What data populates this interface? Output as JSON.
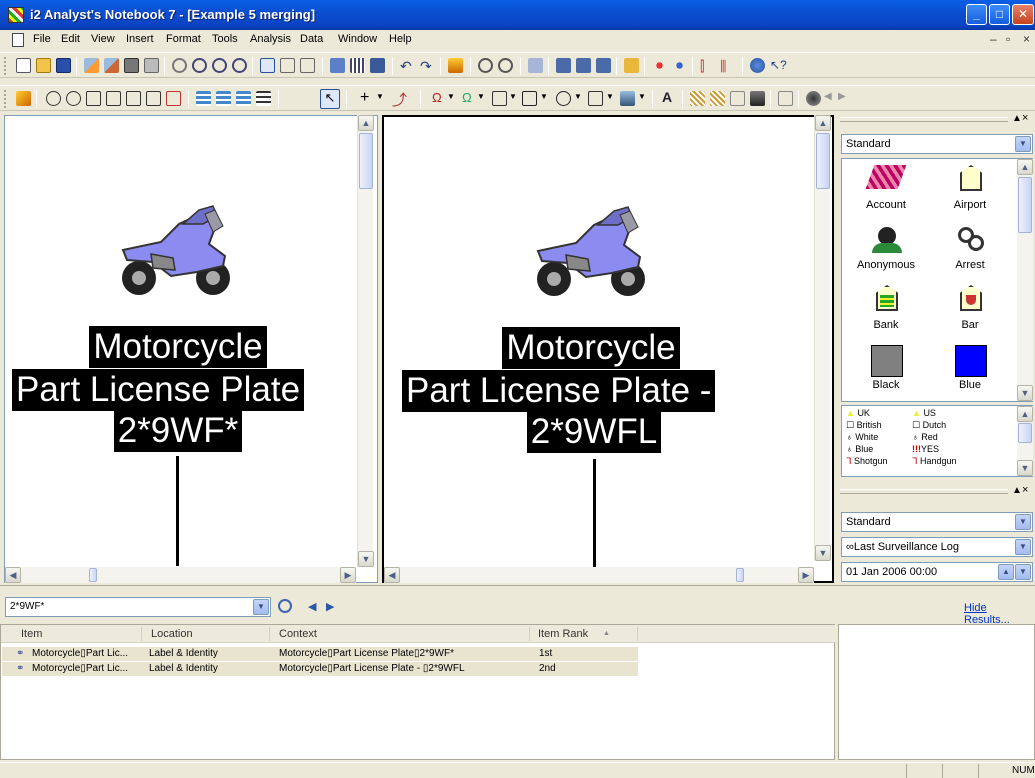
{
  "window": {
    "title": "i2 Analyst's Notebook 7 - [Example 5 merging]"
  },
  "menu": [
    "File",
    "Edit",
    "View",
    "Insert",
    "Format",
    "Tools",
    "Analysis",
    "Data",
    "Window",
    "Help"
  ],
  "charts": {
    "left": {
      "label_lines": [
        "Motorcycle",
        "Part License Plate",
        "2*9WF*"
      ],
      "icon": "motorcycle-icon"
    },
    "right": {
      "label_lines": [
        "Motorcycle",
        "Part License Plate -",
        "2*9WFL"
      ],
      "icon": "motorcycle-icon"
    }
  },
  "palette": {
    "set": "Standard",
    "items": [
      {
        "label": "Account",
        "icon": "account-icon"
      },
      {
        "label": "Airport",
        "icon": "airport-icon"
      },
      {
        "label": "Anonymous",
        "icon": "anonymous-icon"
      },
      {
        "label": "Arrest",
        "icon": "arrest-icon"
      },
      {
        "label": "Bank",
        "icon": "bank-icon"
      },
      {
        "label": "Bar",
        "icon": "bar-icon"
      },
      {
        "label": "Black",
        "icon": "black-swatch",
        "color": "#808080"
      },
      {
        "label": "Blue",
        "icon": "blue-swatch",
        "color": "#0000ff"
      }
    ],
    "legend": [
      {
        "label": "UK"
      },
      {
        "label": "US"
      },
      {
        "label": "British"
      },
      {
        "label": "Dutch"
      },
      {
        "label": "White"
      },
      {
        "label": "Red"
      },
      {
        "label": "Blue"
      },
      {
        "label": "YES",
        "prefix": "!!!"
      },
      {
        "label": "Shotgun"
      },
      {
        "label": "Handgun"
      }
    ],
    "link_set": "Standard",
    "link_type": "Last Surveillance Log",
    "link_type_prefix": "∞",
    "date_value": "01 Jan 2006 00:00"
  },
  "search": {
    "value": "2*9WF*",
    "hide_results": "Hide Results..."
  },
  "results": {
    "columns": [
      "Item",
      "Location",
      "Context",
      "Item Rank"
    ],
    "rows": [
      {
        "item": "Motorcycle▯Part Lic...",
        "location": "Label & Identity",
        "context": "Motorcycle▯Part License Plate▯2*9WF*",
        "rank": "1st"
      },
      {
        "item": "Motorcycle▯Part Lic...",
        "location": "Label & Identity",
        "context": "Motorcycle▯Part License Plate - ▯2*9WFL",
        "rank": "2nd"
      }
    ]
  },
  "status": {
    "num": "NUM"
  },
  "colors": {
    "title_bar": "#0a4ed0",
    "chrome": "#ece9d8"
  }
}
